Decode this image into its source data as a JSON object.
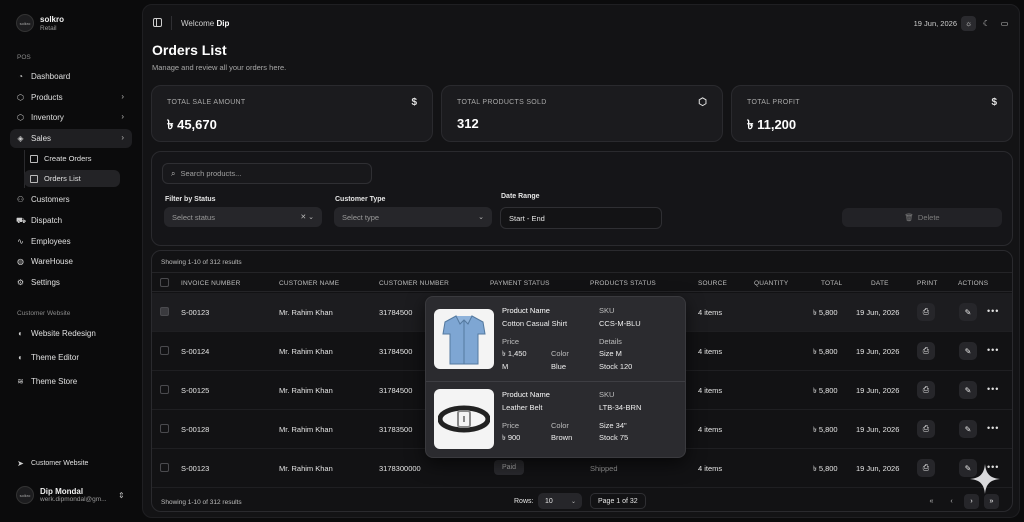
{
  "brand": {
    "name": "solkro",
    "subtitle": "Retail",
    "logo_text": "solkro"
  },
  "sidebar": {
    "section_pos": "POS",
    "items": [
      {
        "label": "Dashboard",
        "icon": "dashboard-icon"
      },
      {
        "label": "Products",
        "icon": "box-icon"
      },
      {
        "label": "Inventory",
        "icon": "box-icon"
      },
      {
        "label": "Sales",
        "icon": "tag-icon"
      },
      {
        "label": "Customers",
        "icon": "users-icon"
      },
      {
        "label": "Dispatch",
        "icon": "truck-icon"
      },
      {
        "label": "Employees",
        "icon": "activity-icon"
      },
      {
        "label": "WareHouse",
        "icon": "warehouse-icon"
      },
      {
        "label": "Settings",
        "icon": "gear-icon"
      }
    ],
    "sales_sub": [
      {
        "label": "Create Orders"
      },
      {
        "label": "Orders List"
      }
    ],
    "section_website": "Customer Website",
    "website_items": [
      {
        "label": "Website Redesign"
      },
      {
        "label": "Theme Editor"
      },
      {
        "label": "Theme Store"
      }
    ],
    "footer_link": "Customer Website",
    "user": {
      "name": "Dip Mondal",
      "email": "werk.dipmondal@gm...",
      "avatar_text": "solkro"
    }
  },
  "topbar": {
    "welcome_prefix": "Welcome",
    "welcome_name": "Dip",
    "date": "19 Jun, 2026"
  },
  "page": {
    "title": "Orders List",
    "subtitle": "Manage and review all your orders here."
  },
  "stats": [
    {
      "label": "TOTAL SALE AMOUNT",
      "value": "৳ 45,670",
      "icon": "$"
    },
    {
      "label": "TOTAL PRODUCTS SOLD",
      "value": "312",
      "icon": "⬡"
    },
    {
      "label": "TOTAL PROFIT",
      "value": "৳ 11,200",
      "icon": "$"
    }
  ],
  "filters": {
    "search_placeholder": "Search products...",
    "status_label": "Filter by Status",
    "status_placeholder": "Select status",
    "customer_label": "Customer Type",
    "customer_placeholder": "Select type",
    "date_label": "Date Range",
    "date_value": "Start - End",
    "delete_label": "Delete"
  },
  "table": {
    "showing": "Showing 1-10 of 312 results",
    "headers": [
      "INVOICE NUMBER",
      "CUSTOMER NAME",
      "CUSTOMER NUMBER",
      "PAYMENT STATUS",
      "PRODUCTS STATUS",
      "SOURCE",
      "QUANTITY",
      "TOTAL",
      "DATE",
      "PRINT",
      "ACTIONS"
    ],
    "rows": [
      {
        "invoice": "S-00123",
        "name": "Mr. Rahim Khan",
        "number": "31784500",
        "payment": "",
        "status": "",
        "source": "4 items",
        "total": "৳ 5,800",
        "date": "19 Jun, 2026"
      },
      {
        "invoice": "S-00124",
        "name": "Mr. Rahim Khan",
        "number": "31784500",
        "payment": "",
        "status": "",
        "source": "4 items",
        "total": "৳ 5,800",
        "date": "19 Jun, 2026"
      },
      {
        "invoice": "S-00125",
        "name": "Mr. Rahim Khan",
        "number": "31784500",
        "payment": "",
        "status": "",
        "source": "4 items",
        "total": "৳ 5,800",
        "date": "19 Jun, 2026"
      },
      {
        "invoice": "S-00128",
        "name": "Mr. Rahim Khan",
        "number": "31783500",
        "payment": "",
        "status": "",
        "source": "4 items",
        "total": "৳ 5,800",
        "date": "19 Jun, 2026"
      },
      {
        "invoice": "S-00123",
        "name": "Mr. Rahim Khan",
        "number": "3178300000",
        "payment": "Paid",
        "status": "Shipped",
        "source": "4 items",
        "total": "৳ 5,800",
        "date": "19 Jun, 2026"
      }
    ],
    "footer_showing": "Showing 1-10 of 312 results",
    "rows_label": "Rows:",
    "rows_value": "10",
    "page_of": "Page 1 of 32"
  },
  "popover": {
    "items": [
      {
        "name_label": "Product Name",
        "name": "Cotton Casual Shirt",
        "sku_label": "SKU",
        "sku": "CCS-M-BLU",
        "price_label": "Price",
        "price": "৳ 1,450",
        "price_sub": "M",
        "color_label": "Color",
        "color": "Blue",
        "details_label": "Details",
        "size": "Size M",
        "stock": "Stock 120",
        "image": "shirt-image"
      },
      {
        "name_label": "Product Name",
        "name": "Leather Belt",
        "sku_label": "SKU",
        "sku": "LTB-34-BRN",
        "price_label": "Price",
        "price": "৳ 900",
        "color_label": "Color",
        "color": "Brown",
        "size": "Size 34\"",
        "stock": "Stock 75",
        "image": "belt-image"
      }
    ]
  },
  "colors": {
    "bg": "#0b0b0c",
    "panel": "#131315",
    "card": "#1b1b1e",
    "popover": "#2b2b2f",
    "text": "#e6e6e6",
    "muted": "#a8a8a8"
  }
}
